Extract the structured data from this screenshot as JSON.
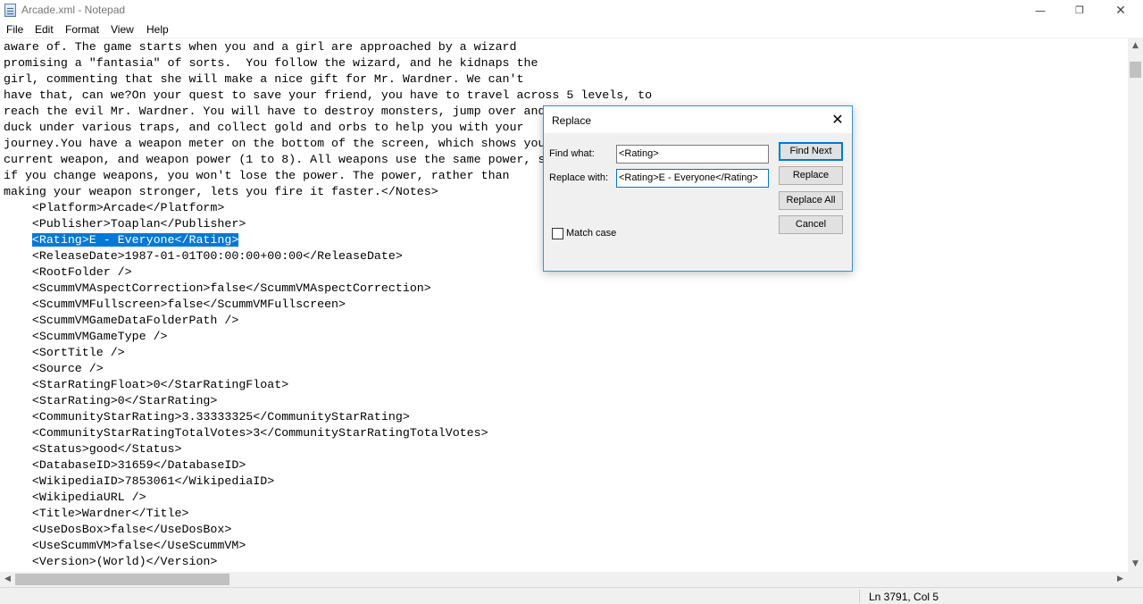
{
  "window": {
    "title": "Arcade.xml - Notepad",
    "controls": {
      "minimize": "—",
      "maximize": "❐",
      "close": "✕"
    }
  },
  "menu": [
    "File",
    "Edit",
    "Format",
    "View",
    "Help"
  ],
  "editor": {
    "lines": [
      "aware of. The game starts when you and a girl are approached by a wizard",
      "promising a \"fantasia\" of sorts.  You follow the wizard, and he kidnaps the",
      "girl, commenting that she will make a nice gift for Mr. Wardner. We can't",
      "have that, can we?On your quest to save your friend, you have to travel across 5 levels, to",
      "reach the evil Mr. Wardner. You will have to destroy monsters, jump over and",
      "duck under various traps, and collect gold and orbs to help you with your",
      "journey.You have a weapon meter on the bottom of the screen, which shows you",
      "current weapon, and weapon power (1 to 8). All weapons use the same power, s",
      "if you change weapons, you won't lose the power. The power, rather than",
      "making your weapon stronger, lets you fire it faster.</Notes>",
      "    <Platform>Arcade</Platform>",
      "    <Publisher>Toaplan</Publisher>",
      "    <Rating>E - Everyone</Rating>",
      "    <ReleaseDate>1987-01-01T00:00:00+00:00</ReleaseDate>",
      "    <RootFolder />",
      "    <ScummVMAspectCorrection>false</ScummVMAspectCorrection>",
      "    <ScummVMFullscreen>false</ScummVMFullscreen>",
      "    <ScummVMGameDataFolderPath />",
      "    <ScummVMGameType />",
      "    <SortTitle />",
      "    <Source />",
      "    <StarRatingFloat>0</StarRatingFloat>",
      "    <StarRating>0</StarRating>",
      "    <CommunityStarRating>3.33333325</CommunityStarRating>",
      "    <CommunityStarRatingTotalVotes>3</CommunityStarRatingTotalVotes>",
      "    <Status>good</Status>",
      "    <DatabaseID>31659</DatabaseID>",
      "    <WikipediaID>7853061</WikipediaID>",
      "    <WikipediaURL />",
      "    <Title>Wardner</Title>",
      "    <UseDosBox>false</UseDosBox>",
      "    <UseScummVM>false</UseScummVM>",
      "    <Version>(World)</Version>"
    ],
    "selected_line_index": 12,
    "selected_text": "<Rating>E - Everyone</Rating>",
    "selection_indent": "    "
  },
  "replace_dialog": {
    "title": "Replace",
    "find_label": "Find what:",
    "find_value": "<Rating>",
    "replace_label": "Replace with:",
    "replace_value": "<Rating>E - Everyone</Rating>",
    "buttons": {
      "find_next": "Find Next",
      "replace": "Replace",
      "replace_all": "Replace All",
      "cancel": "Cancel"
    },
    "match_case_label": "Match case",
    "match_case_checked": false,
    "close": "✕"
  },
  "statusbar": {
    "position": "Ln 3791, Col 5"
  },
  "scrollbars": {
    "up": "▲",
    "down": "▼",
    "left": "◀",
    "right": "▶"
  },
  "colors": {
    "selection": "#0078d7",
    "dialog_border": "#3f8fd8",
    "chrome": "#f0f0f0"
  }
}
